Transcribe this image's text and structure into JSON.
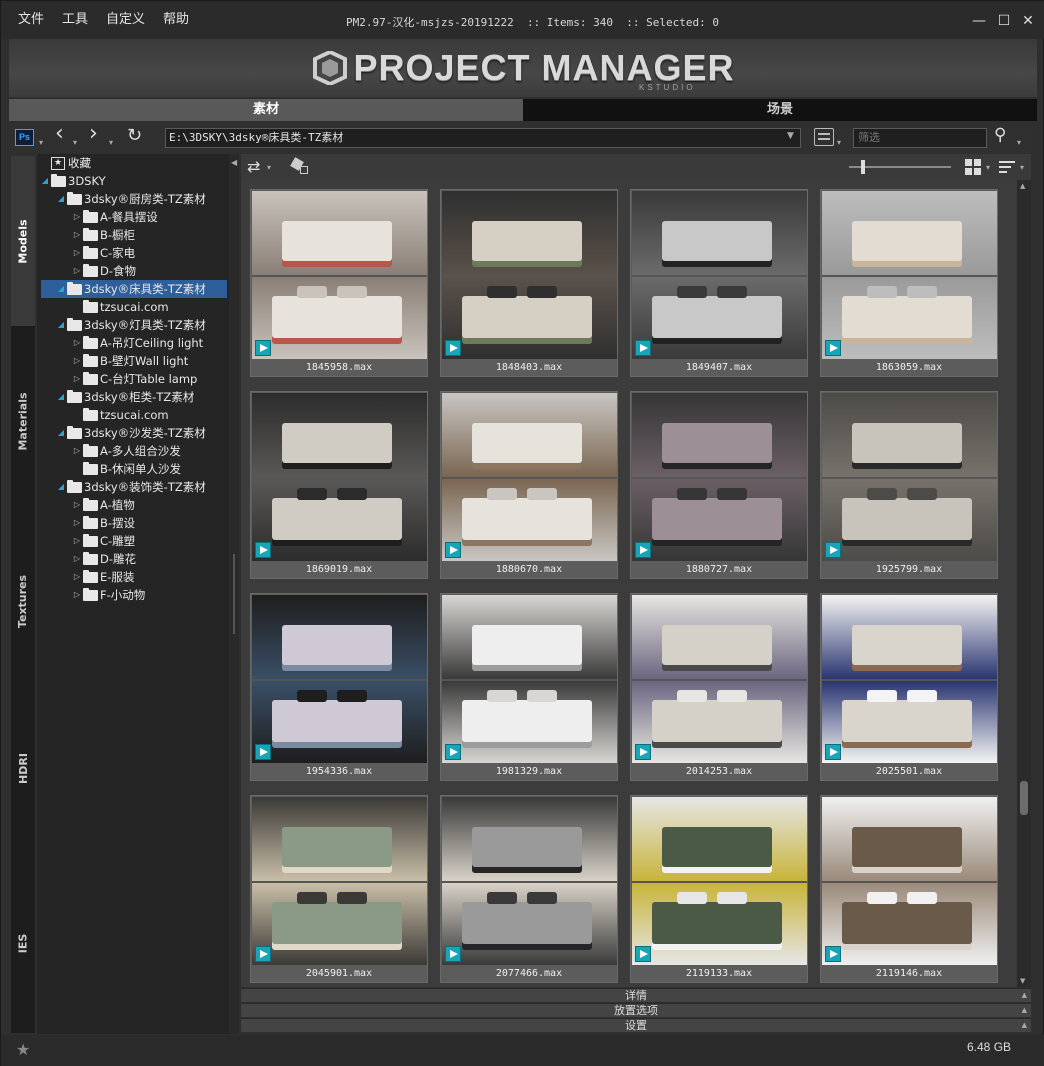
{
  "menu": [
    "文件",
    "工具",
    "自定义",
    "帮助"
  ],
  "window": {
    "title": "PM2.97-汉化-msjzs-20191222  :: Items: 340  :: Selected: 0",
    "min": "—",
    "max": "☐",
    "close": "✕"
  },
  "banner": {
    "title": "PROJECT MANAGER",
    "subtitle": "KSTUDIO"
  },
  "tabs": [
    "素材",
    "场景"
  ],
  "toolbar": {
    "ps_label": "Ps",
    "path": "E:\\3DSKY\\3dsky®床具类-TZ素材",
    "filter_placeholder": "筛选"
  },
  "side_tabs": [
    "Models",
    "Materials",
    "Textures",
    "HDRI",
    "IES"
  ],
  "tree": [
    {
      "label": "收藏",
      "level": 0,
      "arrow": "",
      "icon": "star"
    },
    {
      "label": "3DSKY",
      "level": 0,
      "arrow": "◢",
      "icon": "folder"
    },
    {
      "label": "3dsky®厨房类-TZ素材",
      "level": 1,
      "arrow": "◢",
      "icon": "folder"
    },
    {
      "label": "A-餐具摆设",
      "level": 2,
      "arrow": "▷",
      "icon": "folder"
    },
    {
      "label": "B-橱柜",
      "level": 2,
      "arrow": "▷",
      "icon": "folder"
    },
    {
      "label": "C-家电",
      "level": 2,
      "arrow": "▷",
      "icon": "folder"
    },
    {
      "label": "D-食物",
      "level": 2,
      "arrow": "▷",
      "icon": "folder"
    },
    {
      "label": "3dsky®床具类-TZ素材",
      "level": 1,
      "arrow": "◢",
      "icon": "folder",
      "selected": true
    },
    {
      "label": "tzsucai.com",
      "level": 2,
      "arrow": "",
      "icon": "folder"
    },
    {
      "label": "3dsky®灯具类-TZ素材",
      "level": 1,
      "arrow": "◢",
      "icon": "folder"
    },
    {
      "label": "A-吊灯Ceiling light",
      "level": 2,
      "arrow": "▷",
      "icon": "folder"
    },
    {
      "label": "B-壁灯Wall light",
      "level": 2,
      "arrow": "▷",
      "icon": "folder"
    },
    {
      "label": "C-台灯Table lamp",
      "level": 2,
      "arrow": "▷",
      "icon": "folder"
    },
    {
      "label": "3dsky®柜类-TZ素材",
      "level": 1,
      "arrow": "◢",
      "icon": "folder"
    },
    {
      "label": "tzsucai.com",
      "level": 2,
      "arrow": "",
      "icon": "folder"
    },
    {
      "label": "3dsky®沙发类-TZ素材",
      "level": 1,
      "arrow": "◢",
      "icon": "folder"
    },
    {
      "label": "A-多人组合沙发",
      "level": 2,
      "arrow": "▷",
      "icon": "folder"
    },
    {
      "label": "B-休闲单人沙发",
      "level": 2,
      "arrow": "",
      "icon": "folder"
    },
    {
      "label": "3dsky®装饰类-TZ素材",
      "level": 1,
      "arrow": "◢",
      "icon": "folder"
    },
    {
      "label": "A-植物",
      "level": 2,
      "arrow": "▷",
      "icon": "folder"
    },
    {
      "label": "B-摆设",
      "level": 2,
      "arrow": "▷",
      "icon": "folder"
    },
    {
      "label": "C-雕塑",
      "level": 2,
      "arrow": "▷",
      "icon": "folder"
    },
    {
      "label": "D-雕花",
      "level": 2,
      "arrow": "▷",
      "icon": "folder"
    },
    {
      "label": "E-服装",
      "level": 2,
      "arrow": "▷",
      "icon": "folder"
    },
    {
      "label": "F-小动物",
      "level": 2,
      "arrow": "▷",
      "icon": "folder"
    }
  ],
  "items": [
    {
      "name": "1845958.max",
      "palette": [
        "#c9c3bb",
        "#8a7f77",
        "#e8e2dc",
        "#b5574a"
      ]
    },
    {
      "name": "1848403.max",
      "palette": [
        "#2f2f2f",
        "#5a514a",
        "#d6d0c4",
        "#6a7a5a"
      ]
    },
    {
      "name": "1849407.max",
      "palette": [
        "#3a3a3a",
        "#6b6b6b",
        "#c8c8c8",
        "#222222"
      ]
    },
    {
      "name": "1863059.max",
      "palette": [
        "#bdbdbd",
        "#9a9a9a",
        "#e2dcd3",
        "#c9b59a"
      ]
    },
    {
      "name": "1869019.max",
      "palette": [
        "#2c2c2c",
        "#5a5856",
        "#d0ccc4",
        "#1e1e1e"
      ]
    },
    {
      "name": "1880670.max",
      "palette": [
        "#c9c6c2",
        "#7a6652",
        "#e6e2dc",
        "#8c7660"
      ]
    },
    {
      "name": "1880727.max",
      "palette": [
        "#363636",
        "#6b5f66",
        "#9c8f95",
        "#252525"
      ]
    },
    {
      "name": "1925799.max",
      "palette": [
        "#4d4b48",
        "#77726b",
        "#c8c3bb",
        "#2a2a2a"
      ]
    },
    {
      "name": "1954336.max",
      "palette": [
        "#1e1e1e",
        "#3a4f66",
        "#cfc9d6",
        "#7a8aa0"
      ]
    },
    {
      "name": "1981329.max",
      "palette": [
        "#d8d6d2",
        "#3a3a3a",
        "#eeeeee",
        "#9c9c9c"
      ]
    },
    {
      "name": "2014253.max",
      "palette": [
        "#e8e6e2",
        "#6b6680",
        "#d5d0c8",
        "#4a4a4a"
      ]
    },
    {
      "name": "2025501.max",
      "palette": [
        "#f4f4f4",
        "#2a3570",
        "#d9d4cc",
        "#8b6a4e"
      ]
    },
    {
      "name": "2045901.max",
      "palette": [
        "#3c3a36",
        "#c9bea8",
        "#8a9a86",
        "#e0d8c8"
      ]
    },
    {
      "name": "2077466.max",
      "palette": [
        "#3a3a3a",
        "#d8d2c8",
        "#9a9a9a",
        "#262626"
      ]
    },
    {
      "name": "2119133.max",
      "palette": [
        "#e6e6e6",
        "#c8b43a",
        "#4a5a44",
        "#f2f2f2"
      ]
    },
    {
      "name": "2119146.max",
      "palette": [
        "#f0f0f0",
        "#9a8a7a",
        "#6a5a4a",
        "#d8d2ca"
      ]
    }
  ],
  "bottom_panels": [
    "详情",
    "放置选项",
    "设置"
  ],
  "status": {
    "size": "6.48 GB"
  }
}
